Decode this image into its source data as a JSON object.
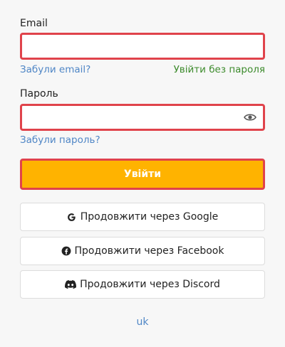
{
  "email": {
    "label": "Email",
    "value": "",
    "placeholder": ""
  },
  "links": {
    "forgot_email": "Забули email?",
    "login_without_password": "Увійти без пароля",
    "forgot_password": "Забули пароль?"
  },
  "password": {
    "label": "Пароль",
    "value": "",
    "placeholder": ""
  },
  "primary_button": {
    "label": "Увійти"
  },
  "social": {
    "google": "Продовжити через Google",
    "facebook": "Продовжити через Facebook",
    "discord": "Продовжити через Discord"
  },
  "language": "uk",
  "colors": {
    "accent": "#ffb300",
    "error_border": "#e0434b",
    "link": "#4f86c6",
    "link_green": "#3c8b2c"
  }
}
